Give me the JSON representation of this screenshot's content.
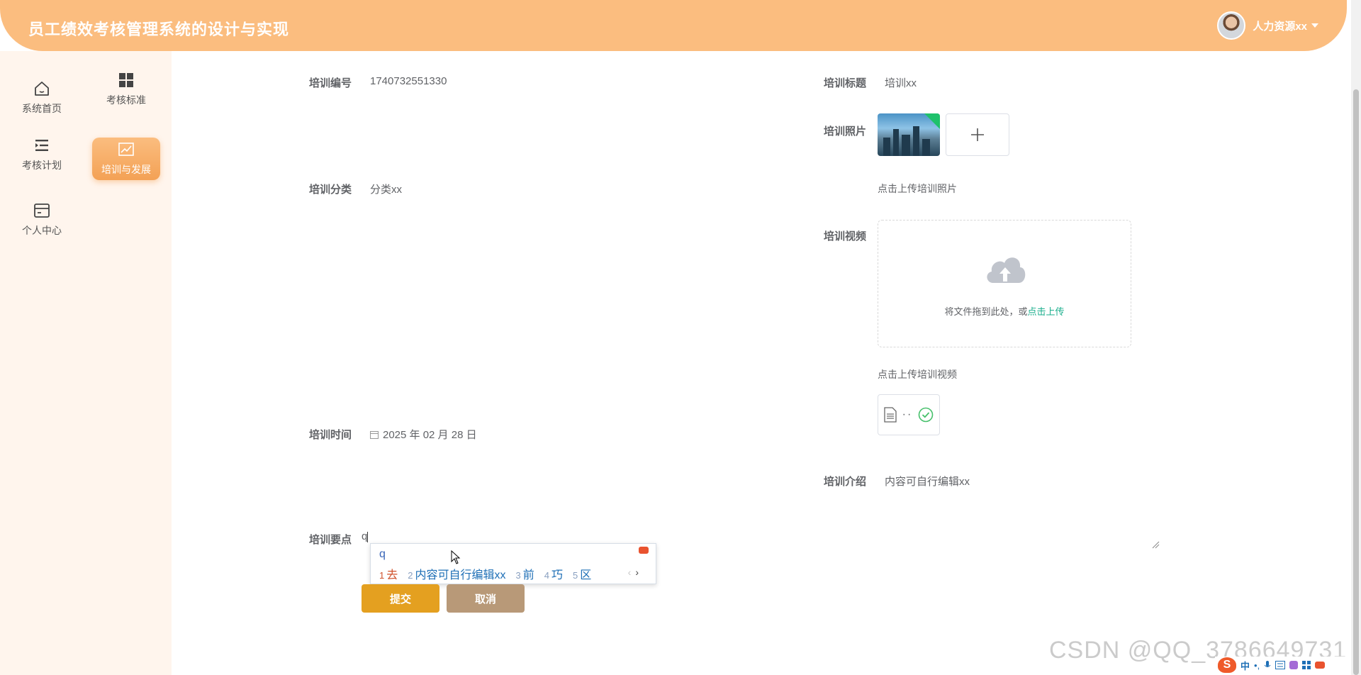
{
  "header": {
    "title": "员工绩效考核管理系统的设计与实现",
    "user_name": "人力资源xx"
  },
  "sidebar": {
    "items": [
      {
        "label": "系统首页",
        "icon": "home-icon"
      },
      {
        "label": "考核标准",
        "icon": "grid-icon"
      },
      {
        "label": "考核计划",
        "icon": "list-indent-icon"
      },
      {
        "label": "培训与发展",
        "icon": "trend-chart-icon"
      },
      {
        "label": "个人中心",
        "icon": "card-icon"
      }
    ],
    "active": "培训与发展"
  },
  "form": {
    "training_no": {
      "label": "培训编号",
      "value": "1740732551330"
    },
    "training_title": {
      "label": "培训标题",
      "value": "培训xx"
    },
    "training_photo": {
      "label": "培训照片",
      "tip": "点击上传培训照片"
    },
    "training_category": {
      "label": "培训分类",
      "value": "分类xx"
    },
    "training_video": {
      "label": "培训视频",
      "drop_text": "将文件拖到此处，或",
      "drop_link": "点击上传",
      "tip": "点击上传培训视频",
      "file_dots": "··"
    },
    "training_time": {
      "label": "培训时间",
      "value": "2025 年 02 月 28 日"
    },
    "training_intro": {
      "label": "培训介绍",
      "value": "内容可自行编辑xx"
    },
    "training_points": {
      "label": "培训要点",
      "value": "q"
    }
  },
  "ime": {
    "input": "q",
    "candidates": [
      {
        "num": "1",
        "text": "去"
      },
      {
        "num": "2",
        "text": "内容可自行编辑xx"
      },
      {
        "num": "3",
        "text": "前"
      },
      {
        "num": "4",
        "text": "巧"
      },
      {
        "num": "5",
        "text": "区"
      }
    ],
    "prev": "‹",
    "next": "›"
  },
  "buttons": {
    "submit": "提交",
    "cancel": "取消"
  },
  "watermark": "CSDN @QQ_3786649731",
  "taskbar_ime": {
    "logo": "S",
    "mode": "中"
  },
  "colors": {
    "header": "#fbbd7f",
    "sidebar": "#fff5ed",
    "submit": "#e4a020",
    "cancel": "#b89978",
    "link": "#1aae8c"
  }
}
